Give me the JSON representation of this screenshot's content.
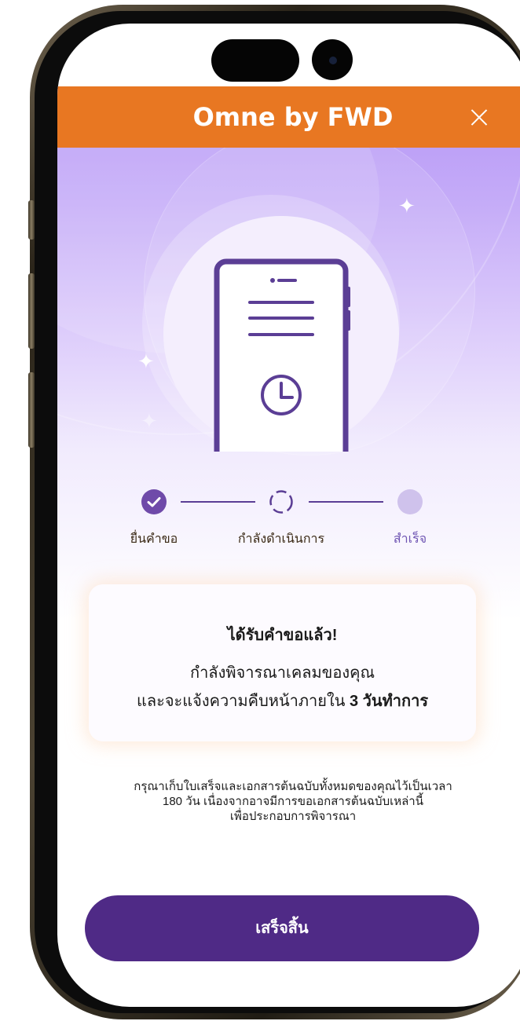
{
  "header": {
    "title": "Omne by FWD",
    "close_icon": "close-icon",
    "background_color": "#e87722"
  },
  "hero": {
    "icon": "phone-document-clock-icon",
    "sparkles": [
      "sparkle-icon",
      "sparkle-icon",
      "sparkle-icon"
    ]
  },
  "progress": {
    "steps": [
      {
        "label": "ยื่นคำขอ",
        "state": "done",
        "icon": "check-icon"
      },
      {
        "label": "กำลังดำเนินการ",
        "state": "in-progress",
        "icon": "loading-ring-icon"
      },
      {
        "label": "สำเร็จ",
        "state": "pending",
        "icon": "pending-dot-icon"
      }
    ],
    "label_color": "#3b2a16",
    "pending_label_color": "#6f55b3"
  },
  "status_card": {
    "title": "ได้รับคำขอแล้ว!",
    "line1": "กำลังพิจารณาเคลมของคุณ",
    "line2_prefix": "และจะแจ้งความคืบหน้าภายใน",
    "line2_bold": "3 วันทำการ"
  },
  "note": {
    "line1": "กรุณาเก็บใบเสร็จและเอกสารต้นฉบับทั้งหมดของคุณไว้เป็นเวลา",
    "line2": "180 วัน เนื่องจากอาจมีการขอเอกสารต้นฉบับเหล่านี้",
    "line3": "เพื่อประกอบการพิจารณา"
  },
  "footer": {
    "finish_label": "เสร็จสิ้น",
    "button_color": "#4f2a86"
  }
}
